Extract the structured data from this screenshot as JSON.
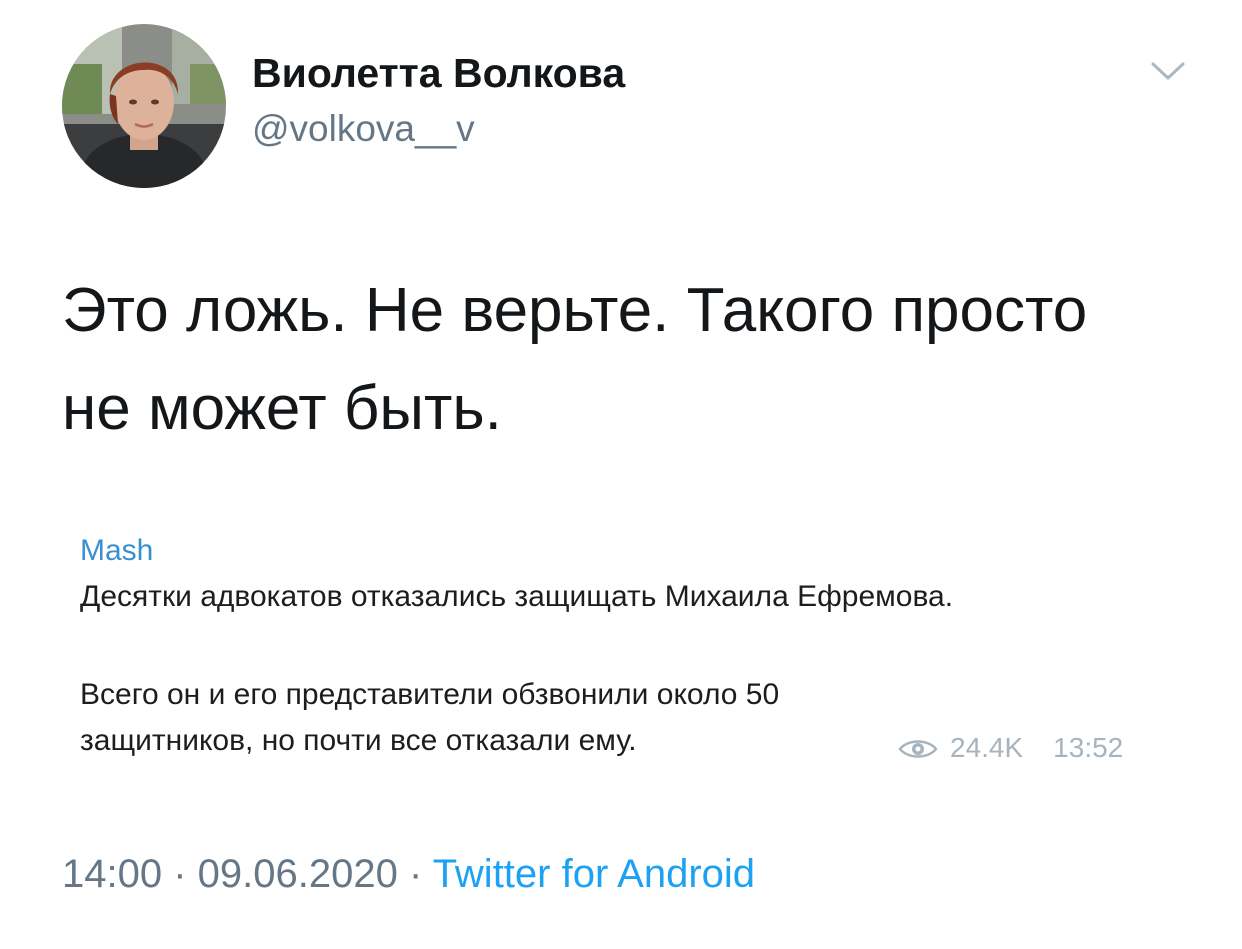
{
  "author": {
    "name": "Виолетта Волкова",
    "handle": "@volkova__v"
  },
  "tweet": {
    "lines": [
      "Это ложь. Не верьте. Такого просто",
      "не может быть."
    ]
  },
  "embed": {
    "channel": "Mash",
    "headline": "Десятки адвокатов отказались защищать Михаила Ефремова.",
    "body_lines": [
      "Всего он и его представители обзвонили около 50",
      "защитников, но почти все отказали ему."
    ],
    "views": "24.4K",
    "time": "13:52"
  },
  "footer": {
    "time": "14:00",
    "separator1": " · ",
    "date": "09.06.2020",
    "separator2": " · ",
    "source": "Twitter for Android"
  },
  "icons": {
    "menu": "chevron-down-icon",
    "views": "eye-icon"
  },
  "colors": {
    "link": "#1da1f2",
    "channel": "#3a8fcf",
    "muted": "#657786",
    "text": "#14171a"
  }
}
